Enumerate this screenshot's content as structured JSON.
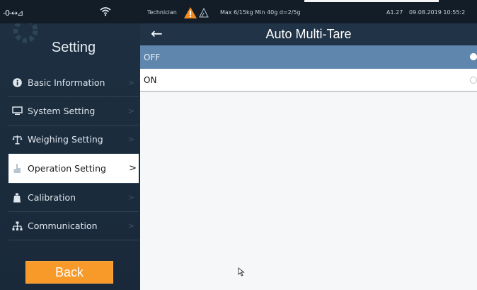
{
  "status": {
    "connection": "-0-↔⊿",
    "user": "Technician",
    "spec": "Max 6/15kg Min 40g d=2/5g",
    "version": "A1.27",
    "datetime": "09.08.2019 10:55:2"
  },
  "sidebar": {
    "title": "Setting",
    "items": [
      {
        "label": "Basic Information",
        "icon": "info-icon"
      },
      {
        "label": "System Setting",
        "icon": "monitor-icon"
      },
      {
        "label": "Weighing Setting",
        "icon": "scale-icon"
      },
      {
        "label": "Operation Setting",
        "icon": "hand-icon",
        "active": true
      },
      {
        "label": "Calibration",
        "icon": "weight-icon"
      },
      {
        "label": "Communication",
        "icon": "network-icon"
      }
    ],
    "back_label": "Back",
    "chevron": ">"
  },
  "header": {
    "title": "Auto Multi-Tare",
    "back_arrow": "←"
  },
  "options": [
    {
      "label": "OFF",
      "selected": true
    },
    {
      "label": "ON",
      "selected": false
    }
  ],
  "colors": {
    "accent": "#f79a2a",
    "selected_row": "#5f86ac",
    "warning": "#f28c1e"
  }
}
